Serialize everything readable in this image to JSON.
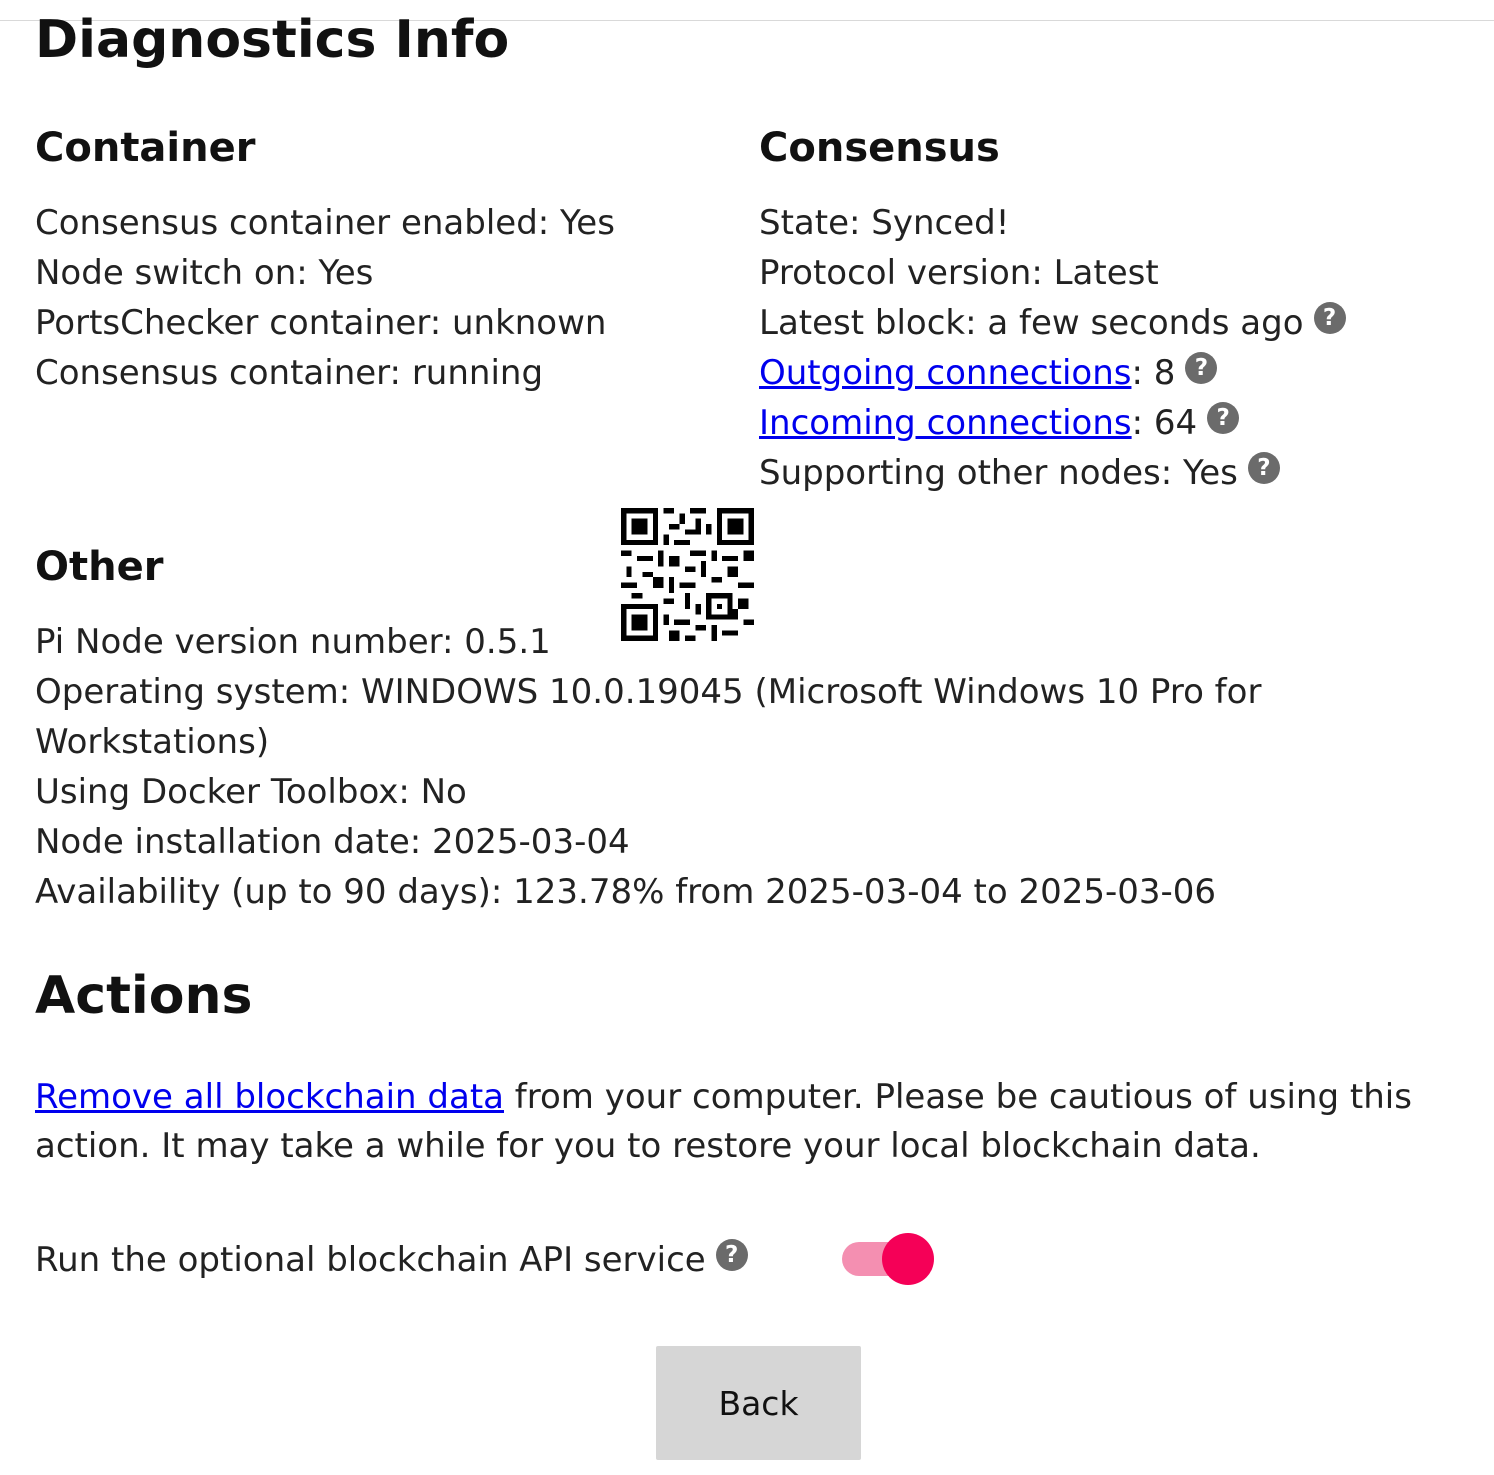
{
  "page": {
    "title": "Diagnostics Info"
  },
  "container": {
    "heading": "Container",
    "lines": [
      "Consensus container enabled: Yes",
      "Node switch on: Yes",
      "PortsChecker container: unknown",
      "Consensus container: running"
    ]
  },
  "consensus": {
    "heading": "Consensus",
    "state": "State: Synced!",
    "protocol": "Protocol version: Latest",
    "latest_block": "Latest block: a few seconds ago",
    "outgoing_link": "Outgoing connections",
    "outgoing_value": ": 8",
    "incoming_link": "Incoming connections",
    "incoming_value": ": 64",
    "supporting": "Supporting other nodes: Yes"
  },
  "other": {
    "heading": "Other",
    "lines": [
      "Pi Node version number: 0.5.1",
      "Operating system: WINDOWS 10.0.19045 (Microsoft Windows 10 Pro for Workstations)",
      "Using Docker Toolbox: No",
      "Node installation date: 2025-03-04",
      "Availability (up to 90 days): 123.78% from 2025-03-04 to 2025-03-06"
    ]
  },
  "actions": {
    "heading": "Actions",
    "remove_link": "Remove all blockchain data",
    "remove_text": " from your computer. Please be cautious of using this action. It may take a while for you to restore your local blockchain data.",
    "api_label": "Run the optional blockchain API service",
    "api_toggle_on": true
  },
  "help_glyph": "?",
  "buttons": {
    "back": "Back"
  },
  "colors": {
    "link": "#0000ee",
    "toggle_thumb": "#f50057",
    "toggle_track": "#f48fb1",
    "help_icon": "#6b6b6b",
    "back_button": "#d6d6d6"
  }
}
